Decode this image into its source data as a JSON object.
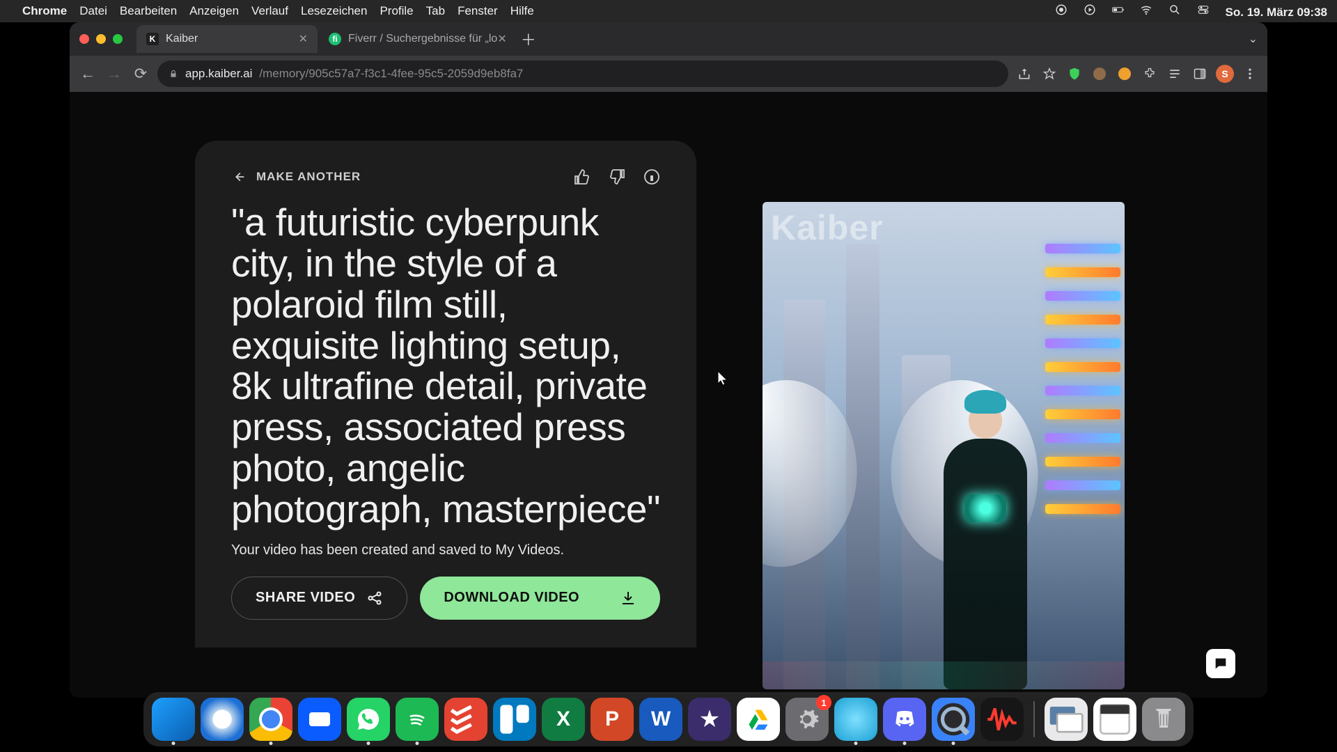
{
  "menubar": {
    "app": "Chrome",
    "items": [
      "Datei",
      "Bearbeiten",
      "Anzeigen",
      "Verlauf",
      "Lesezeichen",
      "Profile",
      "Tab",
      "Fenster",
      "Hilfe"
    ],
    "datetime": "So. 19. März  09:38"
  },
  "tabs": [
    {
      "title": "Kaiber",
      "favicon_letter": "K",
      "favicon_bg": "#1f1f1f",
      "favicon_color": "#fff"
    },
    {
      "title": "Fiverr / Suchergebnisse für „lo",
      "favicon_letter": "fi",
      "favicon_bg": "#1dbf73",
      "favicon_color": "#fff"
    }
  ],
  "url": {
    "host": "app.kaiber.ai",
    "path": "/memory/905c57a7-f3c1-4fee-95c5-2059d9eb8fa7"
  },
  "avatar_initial": "S",
  "card": {
    "back_label": "MAKE ANOTHER",
    "prompt": "\"a futuristic cyberpunk city, in the style of a polaroid film still, exquisite lighting setup, 8k ultrafine detail, private press, associated press photo, angelic photograph, masterpiece\"",
    "status": "Your video has been created and saved to My Videos.",
    "share_label": "SHARE VIDEO",
    "download_label": "DOWNLOAD VIDEO"
  },
  "preview_watermark": "Kaiber",
  "dock": {
    "apps": [
      "finder",
      "safari",
      "chrome",
      "zoom",
      "whatsapp",
      "spotify",
      "todoist",
      "trello",
      "excel",
      "powerpoint",
      "word",
      "imovie",
      "drive",
      "settings",
      "blank",
      "discord",
      "quicktime",
      "audio"
    ],
    "settings_badge": "1"
  }
}
